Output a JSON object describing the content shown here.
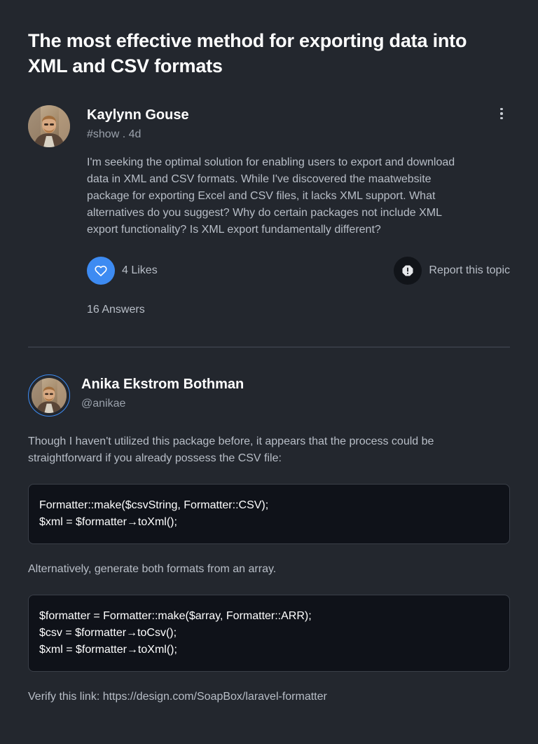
{
  "post": {
    "title": "The most effective method for exporting data into XML and CSV formats",
    "author": "Kaylynn Gouse",
    "meta": "#show . 4d",
    "body": "I'm seeking the optimal solution for enabling users to export and download data in XML and CSV formats. While I've discovered the maatwebsite package for exporting Excel and CSV files, it lacks XML support. What alternatives do you suggest? Why do certain packages not include XML export functionality? Is XML export fundamentally different?",
    "likes_label": "4 Likes",
    "report_label": "Report this topic",
    "answers_label": "16 Answers",
    "icons": {
      "more": "more-vertical-icon",
      "like": "heart-icon",
      "report": "alert-icon"
    }
  },
  "reply": {
    "author": "Anika Ekstrom Bothman",
    "handle": "@anikae",
    "text1": "Though I haven't utilized this package before, it appears that the process could be straightforward if you already possess the CSV file:",
    "code1": [
      "Formatter::make($csvString, Formatter::CSV);",
      "$xml = $formatter→toXml();"
    ],
    "text2": "Alternatively, generate both formats from an array.",
    "code2": [
      "$formatter = Formatter::make($array, Formatter::ARR);",
      "$csv = $formatter→toCsv();",
      "$xml = $formatter→toXml();"
    ],
    "link_text": "Verify this link: https://design.com/SoapBox/laravel-formatter"
  },
  "colors": {
    "background": "#23272e",
    "accent": "#3d8bf2",
    "code_bg": "#0f1219"
  }
}
